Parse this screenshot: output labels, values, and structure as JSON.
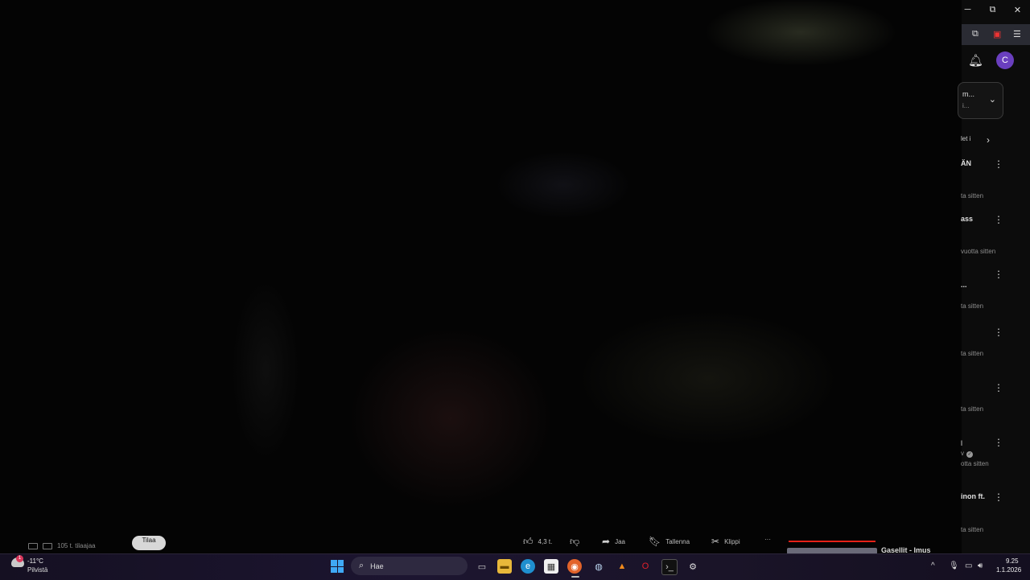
{
  "video_bar": {
    "subscribers": "105 t. tilaajaa",
    "subscribe_label": "Tilaa",
    "likes": "4,3 t.",
    "share": "Jaa",
    "save": "Tallenna",
    "clip": "Klippi",
    "more": "···",
    "next_up_title": "Gasellit - Imus"
  },
  "browser": {
    "minimize": "─",
    "maximize": "⧉",
    "close": "✕",
    "avatar_letter": "C"
  },
  "sidebar": {
    "chip": {
      "line1": "m...",
      "line2": "i..."
    },
    "filter_label": "let i",
    "items": [
      {
        "title": "ÄN",
        "meta": "ta sitten"
      },
      {
        "title": "ass",
        "meta": "vuotta sitten"
      },
      {
        "title": "...",
        "meta": "ta sitten"
      },
      {
        "title": "",
        "meta": "ta sitten"
      },
      {
        "title": "",
        "meta": "ta sitten"
      },
      {
        "title": "l",
        "title2": "v",
        "meta": "otta sitten"
      },
      {
        "title": "inon ft.",
        "meta": "ta sitten"
      }
    ]
  },
  "taskbar": {
    "weather_temp": "-11°C",
    "weather_desc": "Pilvistä",
    "weather_badge": "1",
    "search_placeholder": "Hae",
    "time": "9.25",
    "date": "1.1.2026"
  },
  "colors": {
    "accent_red": "#e62117",
    "avatar_bg": "#6a3fbf",
    "windows_blue": "#3fa9f5"
  }
}
